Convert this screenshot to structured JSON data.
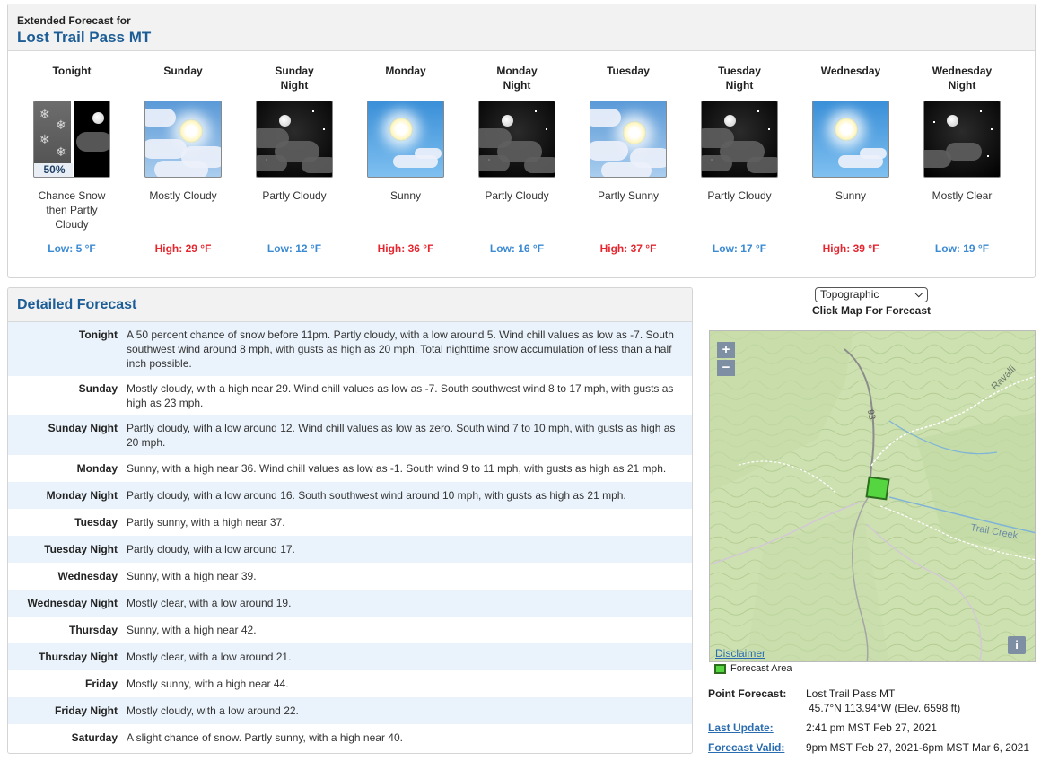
{
  "extended": {
    "label": "Extended Forecast for",
    "location": "Lost Trail Pass MT",
    "periods": [
      {
        "name_l1": "Tonight",
        "name_l2": "",
        "desc_l1": "Chance Snow",
        "desc_l2": "then Partly",
        "desc_l3": "Cloudy",
        "temp": "Low: 5 °F",
        "kind": "low",
        "icon": "snow-then-partly-cloudy-night-icon",
        "pct": "50%"
      },
      {
        "name_l1": "Sunday",
        "name_l2": "",
        "desc_l1": "Mostly Cloudy",
        "desc_l2": "",
        "desc_l3": "",
        "temp": "High: 29 °F",
        "kind": "high",
        "icon": "mostly-cloudy-day-icon"
      },
      {
        "name_l1": "Sunday",
        "name_l2": "Night",
        "desc_l1": "Partly Cloudy",
        "desc_l2": "",
        "desc_l3": "",
        "temp": "Low: 12 °F",
        "kind": "low",
        "icon": "partly-cloudy-night-icon"
      },
      {
        "name_l1": "Monday",
        "name_l2": "",
        "desc_l1": "Sunny",
        "desc_l2": "",
        "desc_l3": "",
        "temp": "High: 36 °F",
        "kind": "high",
        "icon": "sunny-icon"
      },
      {
        "name_l1": "Monday",
        "name_l2": "Night",
        "desc_l1": "Partly Cloudy",
        "desc_l2": "",
        "desc_l3": "",
        "temp": "Low: 16 °F",
        "kind": "low",
        "icon": "partly-cloudy-night-icon"
      },
      {
        "name_l1": "Tuesday",
        "name_l2": "",
        "desc_l1": "Partly Sunny",
        "desc_l2": "",
        "desc_l3": "",
        "temp": "High: 37 °F",
        "kind": "high",
        "icon": "partly-sunny-icon"
      },
      {
        "name_l1": "Tuesday",
        "name_l2": "Night",
        "desc_l1": "Partly Cloudy",
        "desc_l2": "",
        "desc_l3": "",
        "temp": "Low: 17 °F",
        "kind": "low",
        "icon": "partly-cloudy-night-icon"
      },
      {
        "name_l1": "Wednesday",
        "name_l2": "",
        "desc_l1": "Sunny",
        "desc_l2": "",
        "desc_l3": "",
        "temp": "High: 39 °F",
        "kind": "high",
        "icon": "sunny-icon"
      },
      {
        "name_l1": "Wednesday",
        "name_l2": "Night",
        "desc_l1": "Mostly Clear",
        "desc_l2": "",
        "desc_l3": "",
        "temp": "Low: 19 °F",
        "kind": "low",
        "icon": "mostly-clear-night-icon"
      }
    ]
  },
  "detailed": {
    "title": "Detailed Forecast",
    "rows": [
      {
        "label": "Tonight",
        "lines": [
          "A 50 percent chance of snow before 11pm. Partly cloudy, with a low around 5. Wind chill values as low as -7. South",
          "southwest wind around 8 mph, with gusts as high as 20 mph. Total nighttime snow accumulation of less than a half",
          "inch possible."
        ]
      },
      {
        "label": "Sunday",
        "lines": [
          "Mostly cloudy, with a high near 29. Wind chill values as low as -7. South southwest wind 8 to 17 mph, with gusts as",
          "high as 23 mph."
        ]
      },
      {
        "label": "Sunday Night",
        "lines": [
          "Partly cloudy, with a low around 12. Wind chill values as low as zero. South wind 7 to 10 mph, with gusts as high as",
          "20 mph."
        ]
      },
      {
        "label": "Monday",
        "lines": [
          "Sunny, with a high near 36. Wind chill values as low as -1. South wind 9 to 11 mph, with gusts as high as 21 mph."
        ]
      },
      {
        "label": "Monday Night",
        "lines": [
          "Partly cloudy, with a low around 16. South southwest wind around 10 mph, with gusts as high as 21 mph."
        ]
      },
      {
        "label": "Tuesday",
        "lines": [
          "Partly sunny, with a high near 37."
        ]
      },
      {
        "label": "Tuesday Night",
        "lines": [
          "Partly cloudy, with a low around 17."
        ]
      },
      {
        "label": "Wednesday",
        "lines": [
          "Sunny, with a high near 39."
        ]
      },
      {
        "label": "Wednesday Night",
        "lines": [
          "Mostly clear, with a low around 19."
        ]
      },
      {
        "label": "Thursday",
        "lines": [
          "Sunny, with a high near 42."
        ]
      },
      {
        "label": "Thursday Night",
        "lines": [
          "Mostly clear, with a low around 21."
        ]
      },
      {
        "label": "Friday",
        "lines": [
          "Mostly sunny, with a high near 44."
        ]
      },
      {
        "label": "Friday Night",
        "lines": [
          "Mostly cloudy, with a low around 22."
        ]
      },
      {
        "label": "Saturday",
        "lines": [
          "A slight chance of snow. Partly sunny, with a high near 40."
        ]
      }
    ]
  },
  "map": {
    "layer_selected": "Topographic",
    "caption": "Click Map For Forecast",
    "zoom_in": "+",
    "zoom_out": "−",
    "route_label": "93",
    "place_label_1": "Ravalli",
    "place_label_2": "Trail Creek",
    "disclaimer": "Disclaimer",
    "info": "i",
    "legend": "Forecast Area",
    "forecast_area_color": "#55d640"
  },
  "point": {
    "point_label": "Point Forecast:",
    "point_name": "Lost Trail Pass MT",
    "coords": "45.7°N 113.94°W (Elev. 6598 ft)",
    "update_label": "Last Update:",
    "update_value": "2:41 pm MST Feb 27, 2021",
    "valid_label": "Forecast Valid:",
    "valid_value": "9pm MST Feb 27, 2021-6pm MST Mar 6, 2021"
  },
  "colors": {
    "heading_blue": "#1d5d96",
    "low_temp": "#3b8ad4",
    "high_temp": "#e6262e",
    "row_alt": "#eaf3fb"
  }
}
